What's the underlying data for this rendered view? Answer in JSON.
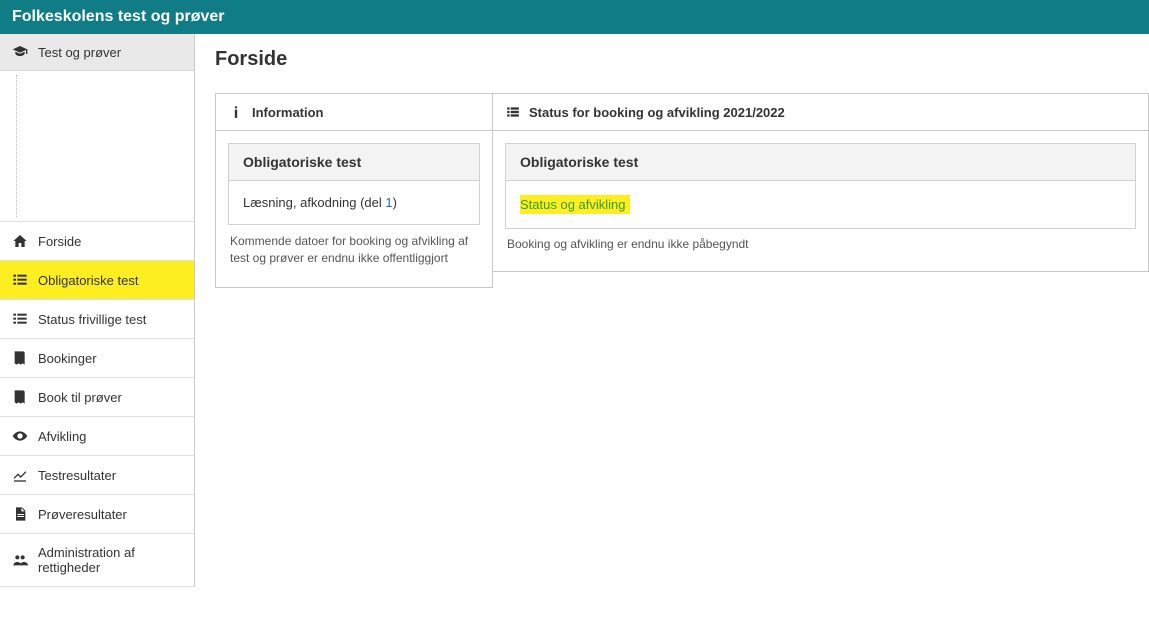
{
  "header": {
    "title": "Folkeskolens test og prøver"
  },
  "sidebar": {
    "header": "Test og prøver",
    "nav": [
      {
        "icon": "home",
        "label": "Forside"
      },
      {
        "icon": "list",
        "label": "Obligatoriske test",
        "highlight": true
      },
      {
        "icon": "list",
        "label": "Status frivillige test"
      },
      {
        "icon": "book",
        "label": "Bookinger"
      },
      {
        "icon": "book",
        "label": "Book til prøver"
      },
      {
        "icon": "eye",
        "label": "Afvikling"
      },
      {
        "icon": "chart",
        "label": "Testresultater"
      },
      {
        "icon": "doc",
        "label": "Prøveresultater"
      },
      {
        "icon": "users",
        "label": "Administration af rettigheder"
      }
    ]
  },
  "main": {
    "title": "Forside",
    "infoPanel": {
      "header": "Information",
      "cardTitle": "Obligatoriske test",
      "cardBodyPrefix": "Læsning, afkodning (del ",
      "cardBodyNum": "1",
      "cardBodySuffix": ")",
      "footer": "Kommende datoer for booking og afvikling af test og prøver er endnu ikke offentliggjort"
    },
    "statusPanel": {
      "header": "Status for booking og afvikling 2021/2022",
      "cardTitle": "Obligatoriske test",
      "link": "Status og afvikling",
      "note": "Booking og afvikling er endnu ikke påbegyndt"
    }
  }
}
